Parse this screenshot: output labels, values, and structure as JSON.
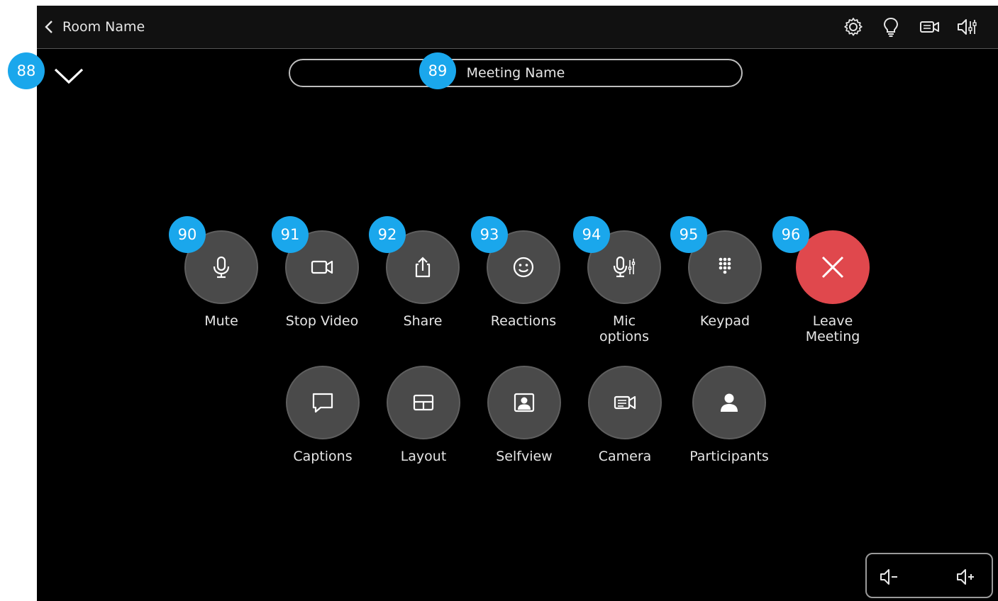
{
  "header": {
    "back_label": "Room Name"
  },
  "top_icons": [
    "settings-icon",
    "lightbulb-icon",
    "camera-settings-icon",
    "volume-adjust-icon"
  ],
  "meeting": {
    "name": "Meeting Name"
  },
  "badges": {
    "collapse": "88",
    "meeting_name": "89"
  },
  "controls_row1": [
    {
      "label": "Mute",
      "badge": "90",
      "icon": "microphone-icon"
    },
    {
      "label": "Stop Video",
      "badge": "91",
      "icon": "video-camera-icon"
    },
    {
      "label": "Share",
      "badge": "92",
      "icon": "share-icon"
    },
    {
      "label": "Reactions",
      "badge": "93",
      "icon": "smiley-icon"
    },
    {
      "label": "Mic options",
      "badge": "94",
      "icon": "mic-options-icon"
    },
    {
      "label": "Keypad",
      "badge": "95",
      "icon": "keypad-icon"
    },
    {
      "label": "Leave Meeting",
      "badge": "96",
      "icon": "close-icon"
    }
  ],
  "controls_row2": [
    {
      "label": "Captions",
      "icon": "captions-icon"
    },
    {
      "label": "Layout",
      "icon": "layout-icon"
    },
    {
      "label": "Selfview",
      "icon": "selfview-icon"
    },
    {
      "label": "Camera",
      "icon": "camera-icon"
    },
    {
      "label": "Participants",
      "icon": "person-icon"
    }
  ],
  "colors": {
    "badge": "#1aa7ec",
    "leave_button": "#e0484d",
    "control_button": "#4a4a4a",
    "background": "#000000"
  }
}
